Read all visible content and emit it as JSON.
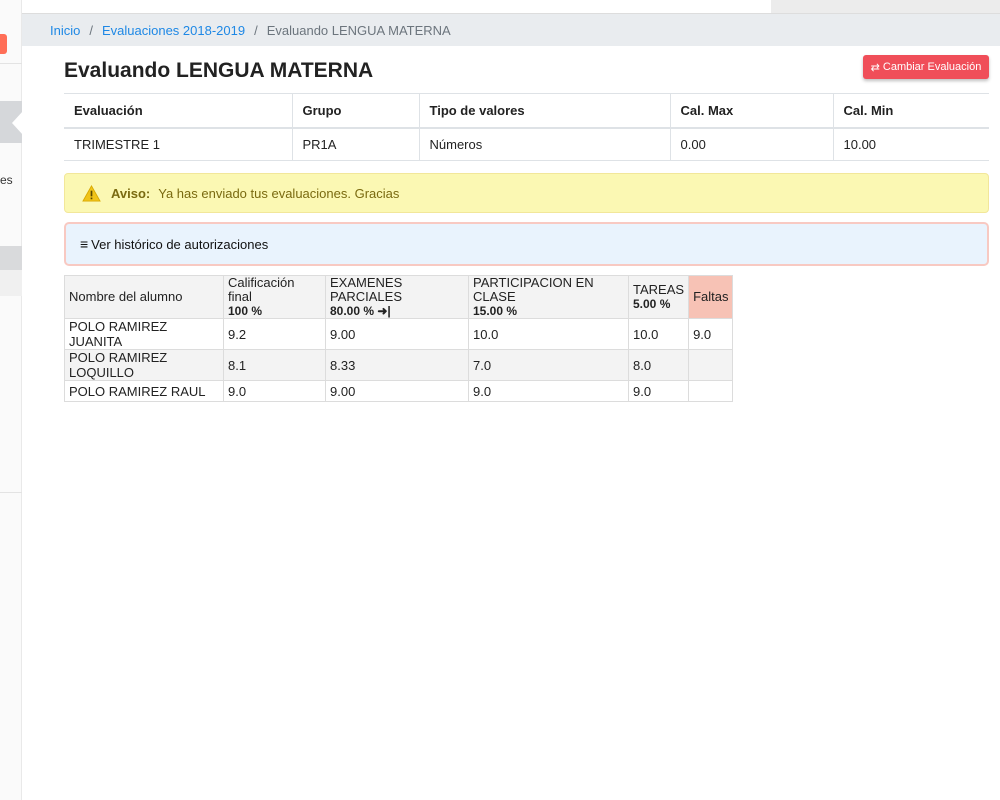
{
  "sidebar": {
    "partial_label": "es"
  },
  "breadcrumb": {
    "items": [
      "Inicio",
      "Evaluaciones 2018-2019"
    ],
    "current": "Evaluando LENGUA MATERNA",
    "separator": "/"
  },
  "page": {
    "title": "Evaluando LENGUA MATERNA",
    "change_button": "Cambiar Evaluación",
    "change_icon": "⇄"
  },
  "info_table": {
    "headers": [
      "Evaluación",
      "Grupo",
      "Tipo de valores",
      "Cal. Max",
      "Cal. Min"
    ],
    "row": [
      "TRIMESTRE 1",
      "PR1A",
      "Números",
      "0.00",
      "10.00"
    ]
  },
  "aviso": {
    "label": "Aviso:",
    "message": "Ya has enviado tus evaluaciones. Gracias",
    "icon": "warning-icon",
    "color": "#fbf8b3"
  },
  "historico": {
    "icon": "≡",
    "label": "Ver histórico de autorizaciones"
  },
  "grades": {
    "columns": [
      {
        "name": "Nombre del alumno",
        "pct": ""
      },
      {
        "name": "Calificación final",
        "pct": "100 %"
      },
      {
        "name": "EXAMENES PARCIALES",
        "pct": "80.00 % ➜|"
      },
      {
        "name": "PARTICIPACION EN CLASE",
        "pct": "15.00 %"
      },
      {
        "name": "TAREAS",
        "pct": "5.00 %"
      },
      {
        "name": "Faltas",
        "pct": ""
      }
    ],
    "rows": [
      [
        "POLO RAMIREZ JUANITA",
        "9.2",
        "9.00",
        "10.0",
        "10.0",
        "9.0"
      ],
      [
        "POLO RAMIREZ LOQUILLO",
        "8.1",
        "8.33",
        "7.0",
        "8.0",
        ""
      ],
      [
        "POLO RAMIREZ RAUL",
        "9.0",
        "9.00",
        "9.0",
        "9.0",
        ""
      ]
    ]
  },
  "colors": {
    "accent_link": "#1e88e5",
    "danger_button": "#f04e59",
    "faltas_header": "#f7c2b5"
  }
}
